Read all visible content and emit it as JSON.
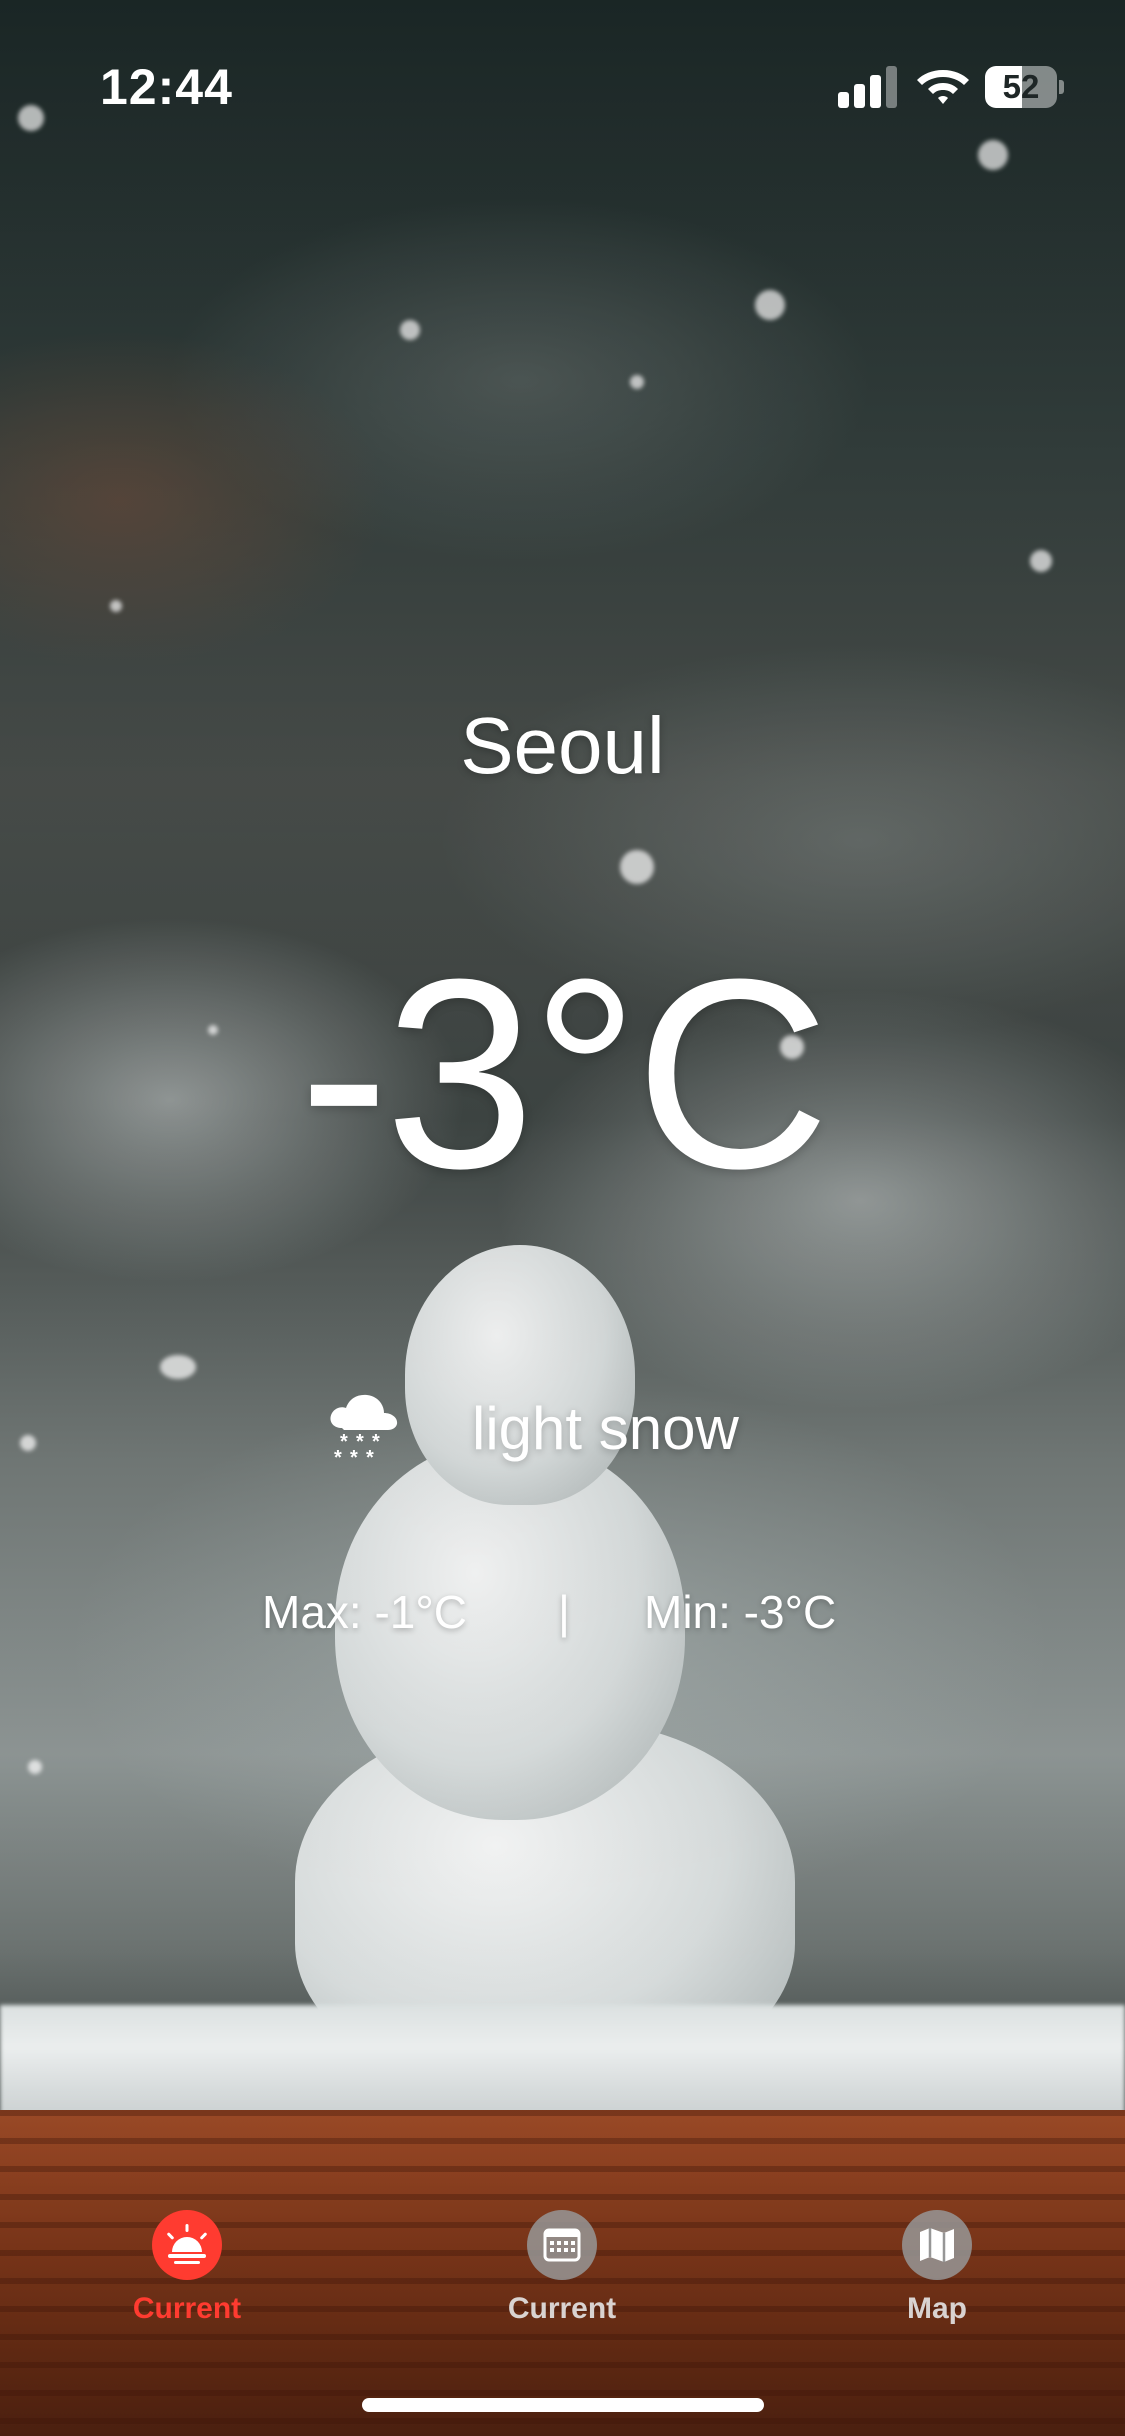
{
  "status_bar": {
    "time": "12:44",
    "battery_level": "52",
    "battery_fraction": 0.52,
    "icons": [
      "cellular-signal-icon",
      "wifi-icon",
      "battery-icon"
    ]
  },
  "weather": {
    "city": "Seoul",
    "temperature": "-3°C",
    "condition": "light snow",
    "condition_icon": "light-snow-icon",
    "max": "Max: -1°C",
    "divider": "|",
    "min": "Min: -3°C"
  },
  "tab_bar": {
    "active_color": "#ff3b30",
    "inactive_color": "#969696",
    "tabs": [
      {
        "label": "Current",
        "icon": "sunrise-icon",
        "active": true
      },
      {
        "label": "Current",
        "icon": "calendar-icon",
        "active": false
      },
      {
        "label": "Map",
        "icon": "map-icon",
        "active": false
      }
    ]
  }
}
